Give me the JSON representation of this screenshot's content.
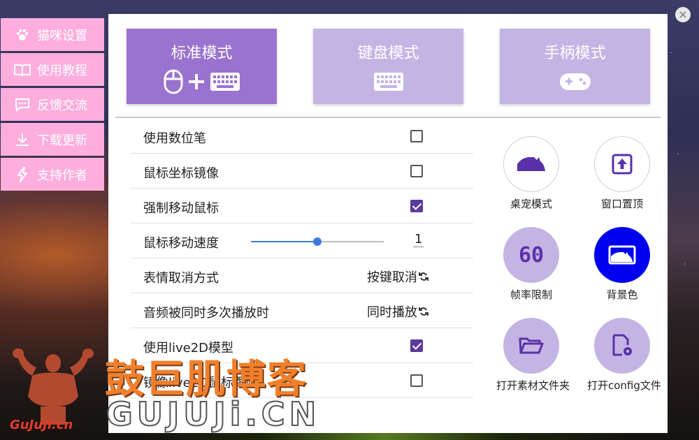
{
  "sidebar": {
    "items": [
      {
        "label": "猫咪设置",
        "icon": "paw-icon"
      },
      {
        "label": "使用教程",
        "icon": "book-icon"
      },
      {
        "label": "反馈交流",
        "icon": "chat-icon"
      },
      {
        "label": "下载更新",
        "icon": "download-icon"
      },
      {
        "label": "支持作者",
        "icon": "lightning-icon"
      }
    ]
  },
  "modes": [
    {
      "title": "标准模式",
      "icon": "mouse-plus-keyboard-icon",
      "active": true
    },
    {
      "title": "键盘模式",
      "icon": "keyboard-icon",
      "active": false
    },
    {
      "title": "手柄模式",
      "icon": "gamepad-icon",
      "active": false
    }
  ],
  "settings": {
    "digital_pen": {
      "label": "使用数位笔",
      "checked": false
    },
    "mouse_mirror": {
      "label": "鼠标坐标镜像",
      "checked": false
    },
    "force_move_mouse": {
      "label": "强制移动鼠标",
      "checked": true
    },
    "mouse_speed": {
      "label": "鼠标移动速度",
      "value": "1",
      "slider_fraction": 0.5
    },
    "expression_cancel": {
      "label": "表情取消方式",
      "option": "按键取消"
    },
    "audio_multi": {
      "label": "音频被同时多次播放时",
      "option": "同时播放"
    },
    "use_live2d": {
      "label": "使用live2D模型",
      "checked": true
    },
    "mirror_live2d": {
      "label": "镜像live2D鼠标跟随",
      "checked": false
    }
  },
  "tools": {
    "pet_mode": "桌宠模式",
    "window_top": "窗口置顶",
    "fps_limit": "帧率限制",
    "fps_value": "60",
    "bg_color": "背景色",
    "open_assets": "打开素材文件夹",
    "open_config": "打开config文件"
  },
  "colors": {
    "accent_active": "#9a72cf",
    "accent_inactive": "#c4b4e4",
    "sidebar_pink": "#fdaedd",
    "check_purple": "#5b3a9b",
    "bg_color_blue": "#0000f0"
  },
  "watermark": {
    "cn": "鼓巨肌博客",
    "en": "GUJUJi.CN",
    "small": "GuJuJi.cn"
  }
}
